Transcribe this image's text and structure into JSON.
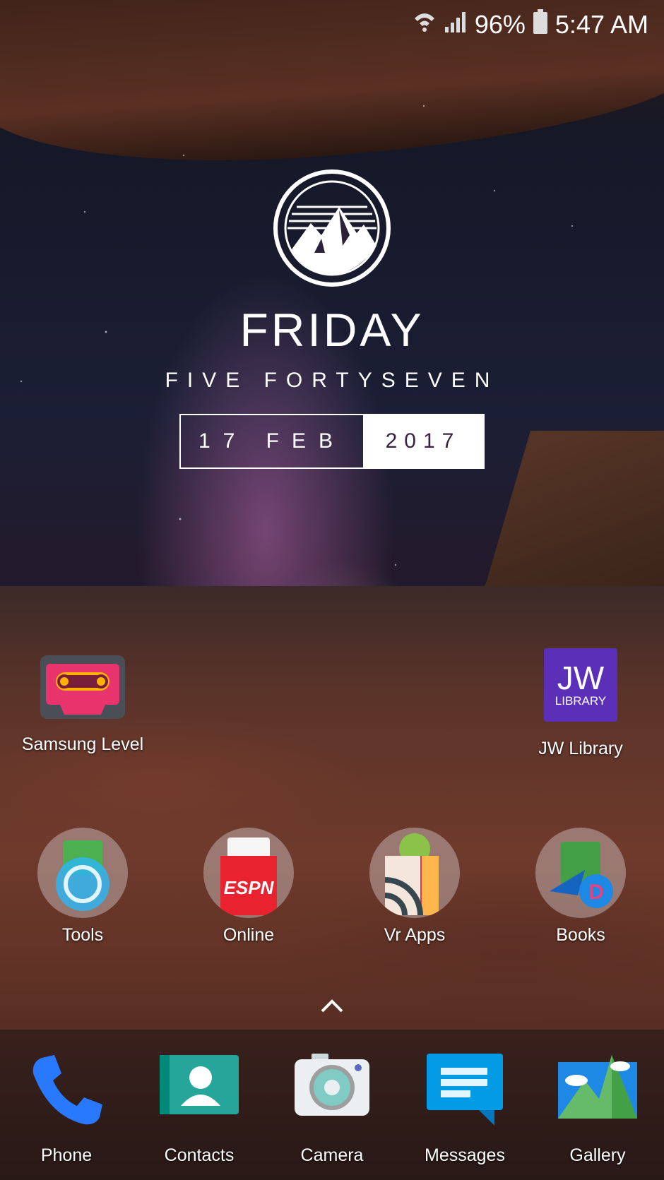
{
  "status_bar": {
    "battery": "96%",
    "time": "5:47 AM"
  },
  "widget": {
    "day": "FRIDAY",
    "time_text": "FIVE  FORTYSEVEN",
    "date": "17 FEB",
    "year": "2017"
  },
  "apps": {
    "samsung_level": "Samsung Level",
    "jw_library": "JW Library",
    "jw_icon_big": "JW",
    "jw_icon_small": "LIBRARY"
  },
  "folders": [
    "Tools",
    "Online",
    "Vr Apps",
    "Books"
  ],
  "dock": [
    "Phone",
    "Contacts",
    "Camera",
    "Messages",
    "Gallery"
  ]
}
